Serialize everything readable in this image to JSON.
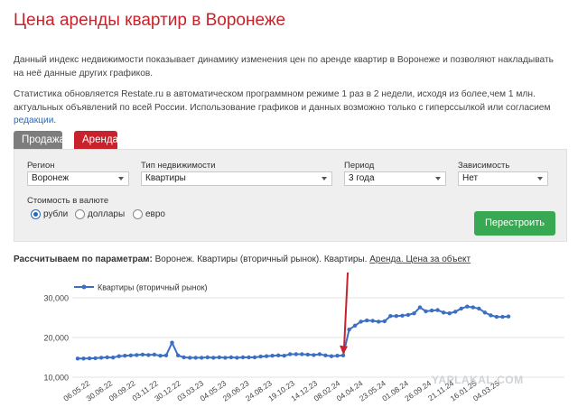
{
  "page": {
    "title": "Цена аренды квартир в Воронеже",
    "intro1": "Данный индекс недвижимости показывает динамику изменения цен по аренде квартир в Воронеже и позволяют накладывать на неё данные других графиков.",
    "intro2_text": "Статистика обновляется Restate.ru в автоматическом программном режиме 1 раз в 2 недели, исходя из более,чем 1 млн. актуальных объявлений по всей России. Использование графиков и данных возможно только с гиперссылкой или согласием",
    "intro2_link": "редакции",
    "intro2_end": "."
  },
  "tabs": [
    {
      "label": "Продажа",
      "active": false
    },
    {
      "label": "Аренда",
      "active": true
    }
  ],
  "filters": {
    "region": {
      "label": "Регион",
      "value": "Воронеж"
    },
    "type": {
      "label": "Тип недвижимости",
      "value": "Квартиры"
    },
    "period": {
      "label": "Период",
      "value": "3 года"
    },
    "dependency": {
      "label": "Зависимость",
      "value": "Нет"
    },
    "currency": {
      "label": "Стоимость в валюте",
      "options": [
        "рубли",
        "доллары",
        "евро"
      ],
      "selected": "рубли"
    },
    "rebuild_label": "Перестроить"
  },
  "params": {
    "bold": "Рассчитываем по параметрам:",
    "p1": "Воронеж. Квартиры (вторичный рынок). Квартиры.",
    "p2": "Аренда. Цена за объект"
  },
  "watermark": "YAPLAKAL.COM",
  "colors": {
    "accent": "#c8232c",
    "line": "#3b6fc6",
    "button": "#39a852",
    "tab_inactive": "#7d7d7d"
  },
  "chart_data": {
    "type": "line",
    "title": "",
    "xlabel": "",
    "ylabel": "",
    "ylim": [
      10000,
      30000
    ],
    "yticks": [
      "10,000",
      "20,000",
      "30,000"
    ],
    "grid": true,
    "legend_position": "top-left",
    "x_tick_labels": [
      "06.05.22",
      "30.06.22",
      "09.09.22",
      "03.11.22",
      "30.12.22",
      "03.03.23",
      "04.05.23",
      "29.06.23",
      "24.08.23",
      "19.10.23",
      "14.12.23",
      "08.02.24",
      "04.04.24",
      "23.05.24",
      "01.08.24",
      "26.09.24",
      "21.11.24",
      "16.01.25",
      "04.03.25"
    ],
    "series": [
      {
        "name": "Квартиры (вторичный рынок)",
        "values": [
          14700,
          14700,
          14750,
          14800,
          14900,
          15000,
          14950,
          15300,
          15400,
          15500,
          15600,
          15700,
          15600,
          15700,
          15400,
          15500,
          18700,
          15500,
          15000,
          14900,
          14900,
          14900,
          15000,
          14900,
          15000,
          14900,
          15000,
          14900,
          15000,
          15000,
          15000,
          15200,
          15300,
          15400,
          15500,
          15400,
          15800,
          15800,
          15800,
          15700,
          15600,
          15800,
          15500,
          15300,
          15400,
          15500,
          22000,
          23000,
          24000,
          24300,
          24200,
          24000,
          24100,
          25400,
          25400,
          25500,
          25700,
          26100,
          27600,
          26600,
          26800,
          26900,
          26300,
          26100,
          26500,
          27300,
          27800,
          27600,
          27300,
          26300,
          25600,
          25200,
          25200,
          25300
        ]
      }
    ],
    "annotations": [
      {
        "type": "arrow",
        "color": "#c8232c",
        "target_index": 45
      }
    ]
  }
}
